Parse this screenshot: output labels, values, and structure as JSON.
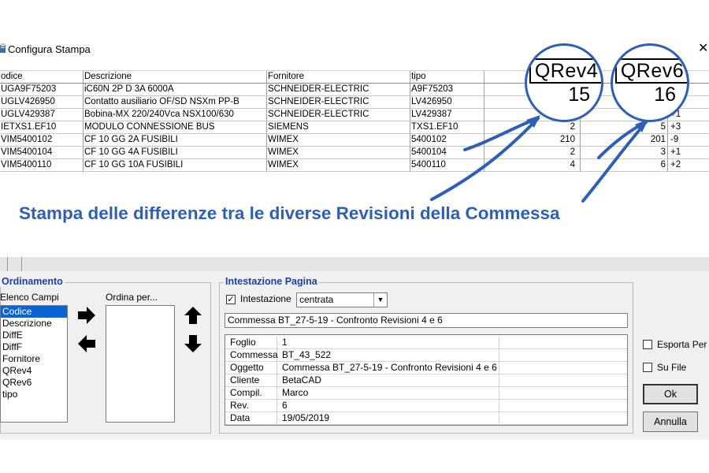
{
  "window": {
    "title": "Configura Stampa",
    "close_glyph": "✕"
  },
  "grid": {
    "columns": [
      "odice",
      "Descrizione",
      "Fornitore",
      "tipo",
      "",
      "",
      ""
    ],
    "rows": [
      [
        "UGA9F75203",
        "iC60N 2P D   3A 6000A",
        "SCHNEIDER-ELECTRIC",
        "A9F75203",
        "",
        "",
        ""
      ],
      [
        "UGLV426950",
        "Contatto ausiliario OF/SD NSXm PP-B",
        "SCHNEIDER-ELECTRIC",
        "LV426950",
        "",
        "",
        ""
      ],
      [
        "UGLV429387",
        "Bobina-MX 220/240Vca NSX100/630",
        "SCHNEIDER-ELECTRIC",
        "LV429387",
        "",
        "",
        "+1"
      ],
      [
        "IETXS1.EF10",
        "MODULO CONNESSIONE BUS",
        "SIEMENS",
        "TXS1.EF10",
        "2",
        "5",
        "+3"
      ],
      [
        "VIM5400102",
        "CF 10 GG   2A  FUSIBILI",
        "WIMEX",
        "5400102",
        "210",
        "201",
        "-9"
      ],
      [
        "VIM5400104",
        "CF 10 GG   4A  FUSIBILI",
        "WIMEX",
        "5400104",
        "2",
        "3",
        "+1"
      ],
      [
        "VIM5400110",
        "CF 10 GG  10A  FUSIBILI",
        "WIMEX",
        "5400110",
        "4",
        "6",
        "+2"
      ]
    ]
  },
  "callouts": [
    {
      "header": "QRev4",
      "value": "15"
    },
    {
      "header": "QRev6",
      "value": "16"
    }
  ],
  "caption": "Stampa delle differenze tra le diverse Revisioni della Commessa",
  "ordinamento": {
    "title": "Ordinamento",
    "fields_label": "Elenco Campi",
    "order_label": "Ordina per...",
    "fields": [
      "Codice",
      "Descrizione",
      "DiffE",
      "DiffF",
      "Fornitore",
      "QRev4",
      "QRev6",
      "tipo"
    ],
    "selected_index": 0
  },
  "intestazione": {
    "title": "Intestazione Pagina",
    "checkbox_label": "Intestazione",
    "checkbox_checked": true,
    "alignment": "centrata",
    "header_text": "Commessa BT_27-5-19 - Confronto Revisioni 4 e 6",
    "info_rows": [
      [
        "Foglio",
        "1"
      ],
      [
        "Commessa",
        "BT_43_522"
      ],
      [
        "Oggetto",
        "Commessa BT_27-5-19 - Confronto Revisioni 4 e 6"
      ],
      [
        "Cliente",
        "BetaCAD"
      ],
      [
        "Compil.",
        "Marco"
      ],
      [
        "Rev.",
        "6"
      ],
      [
        "Data",
        "19/05/2019"
      ]
    ]
  },
  "options": {
    "esporta_label": "Esporta Per",
    "su_file_label": "Su File",
    "ok_label": "Ok",
    "annulla_label": "Annulla"
  },
  "colors": {
    "accent": "#2d5fb8",
    "selection": "#0a64d8",
    "group_title": "#1a3fa8"
  },
  "icons": [
    "app-icon",
    "arrow-right-icon",
    "arrow-left-icon",
    "arrow-up-icon",
    "arrow-down-icon",
    "dropdown-arrow-icon"
  ]
}
